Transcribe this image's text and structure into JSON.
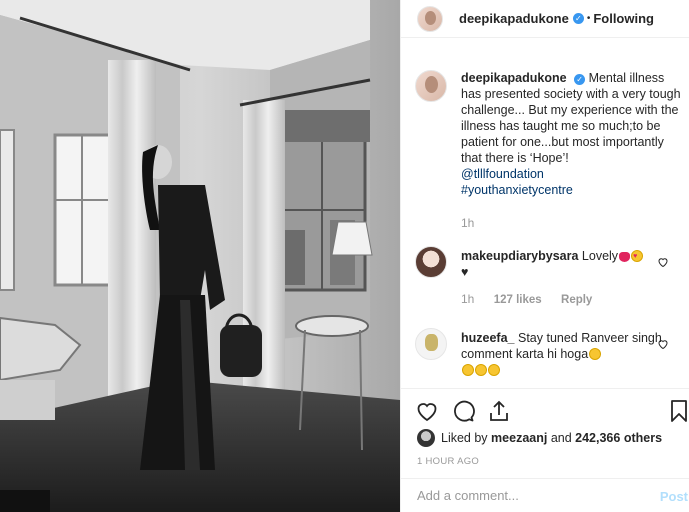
{
  "header": {
    "username": "deepikapadukone",
    "separator": "•",
    "follow_status": "Following"
  },
  "caption": {
    "username": "deepikapadukone",
    "text": "Mental illness has presented society with a very tough challenge... But my experience with the illness has taught me so much;to be patient for one...but most importantly that there is ‘Hope’!",
    "mention": "@tlllfoundation",
    "hashtag": "#youthanxietycentre",
    "time": "1h"
  },
  "comments": [
    {
      "username": "makeupdiarybysara",
      "text": "Lovely",
      "time": "1h",
      "likes": "127 likes",
      "reply": "Reply"
    },
    {
      "username": "huzeefa_",
      "text": "Stay tuned Ranveer singh comment karta hi hoga",
      "time": "",
      "likes": "",
      "reply": ""
    }
  ],
  "likes": {
    "prefix": "Liked by",
    "user": "meezaanj",
    "connector": "and",
    "others": "242,366 others"
  },
  "timestamp": "1 HOUR AGO",
  "add_comment": {
    "placeholder": "Add a comment...",
    "post_label": "Post"
  },
  "colors": {
    "link": "#003569",
    "verified": "#3897f0",
    "post_disabled": "#b2dffc",
    "muted": "#999999"
  },
  "icons": [
    "verified-badge-icon",
    "heart-icon",
    "comment-icon",
    "share-icon",
    "bookmark-icon"
  ]
}
